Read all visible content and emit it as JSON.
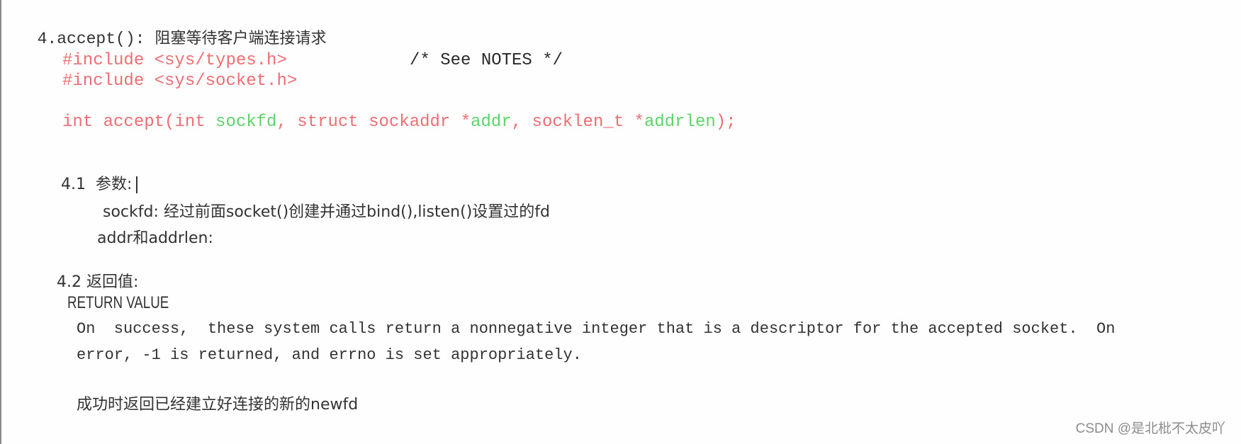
{
  "heading": {
    "number": "4.accept():",
    "description": "阻塞等待客户端连接请求"
  },
  "synopsis": {
    "include1": "#include <sys/types.h>",
    "include1_comment": "/* See NOTES */",
    "include2": "#include <sys/socket.h>",
    "prototype": {
      "p1": "int accept(int ",
      "arg1": "sockfd",
      "p2": ", struct sockaddr *",
      "arg2": "addr",
      "p3": ", socklen_t *",
      "arg3": "addrlen",
      "p4": ");"
    }
  },
  "section_params": {
    "title": "4.1  参数:",
    "sockfd_line": "sockfd: 经过前面socket()创建并通过bind(),listen()设置过的fd",
    "addr_line": "addr和addrlen:"
  },
  "section_return": {
    "title": "4.2 返回值:",
    "heading": "RETURN VALUE",
    "line1": "On  success,  these system calls return a nonnegative integer that is a descriptor for the accepted socket.  On",
    "line2": "error, -1 is returned, and errno is set appropriately.",
    "note": "成功时返回已经建立好连接的新的newfd"
  },
  "watermark": "CSDN @是北枇不太皮吖",
  "colors": {
    "code_red": "#ee6e73",
    "code_green": "#5fd36a",
    "text": "#333333"
  }
}
